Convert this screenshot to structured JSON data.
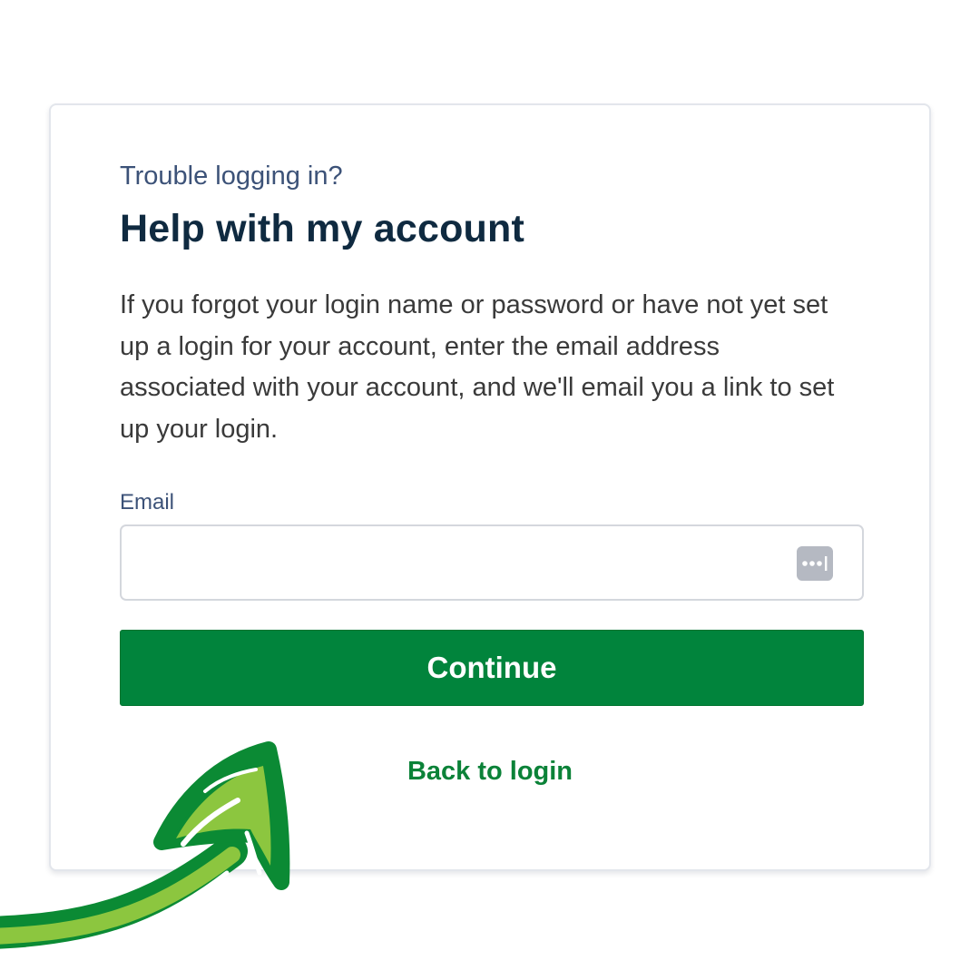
{
  "card": {
    "eyebrow": "Trouble logging in?",
    "title": "Help with my account",
    "description": "If you forgot your login name or password or have not yet set up a login for your account, enter the email address associated with your account, and we'll email you a link to set up your login."
  },
  "form": {
    "email_label": "Email",
    "email_value": "",
    "continue_label": "Continue",
    "back_label": "Back to login"
  },
  "icons": {
    "password_manager": "password-dots-icon",
    "arrow": "hand-drawn-arrow"
  },
  "colors": {
    "primary_green": "#01843c",
    "light_green": "#8cc63f",
    "title": "#0f2a40",
    "eyebrow": "#3c5278"
  }
}
